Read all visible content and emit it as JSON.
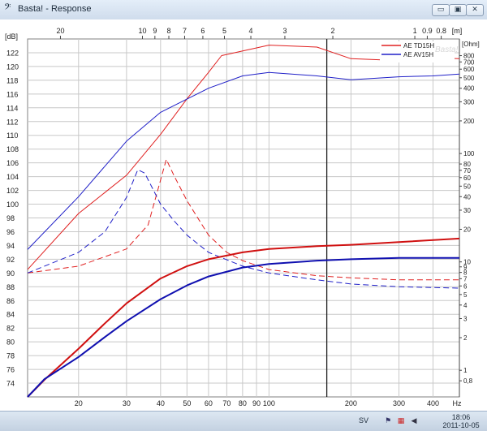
{
  "window": {
    "title": "Basta! - Response",
    "app_icon": "bass-clef-icon",
    "controls": {
      "minimize": "▭",
      "maximize": "▣",
      "close": "✕"
    }
  },
  "chart_data": {
    "type": "line",
    "xaxis": {
      "scale": "log",
      "range": [
        13,
        500
      ],
      "unit_label": "Hz",
      "ticks": [
        20,
        30,
        40,
        50,
        60,
        70,
        80,
        90,
        100,
        200,
        300,
        400
      ]
    },
    "topaxis": {
      "unit_label": "[m]",
      "range_m": [
        26.4,
        0.686
      ],
      "ticks": [
        20,
        10,
        9,
        8,
        7,
        6,
        5,
        4,
        3,
        2,
        1,
        0.9,
        0.8
      ]
    },
    "yaxis": {
      "unit_label": "[dB]",
      "range": [
        72,
        124
      ],
      "ticks": [
        74,
        76,
        78,
        80,
        82,
        84,
        86,
        88,
        90,
        92,
        94,
        96,
        98,
        100,
        102,
        104,
        106,
        108,
        110,
        112,
        114,
        116,
        118,
        120,
        122
      ]
    },
    "y2axis": {
      "unit_label": "[Ohm]",
      "scale": "log",
      "range": [
        0.568,
        1140
      ],
      "ticks": [
        "0,8",
        "1",
        "2",
        "3",
        "4",
        "5",
        "6",
        "7",
        "8",
        "9",
        "10",
        "20",
        "30",
        "40",
        "50",
        "60",
        "70",
        "80",
        "100",
        "200",
        "300",
        "400",
        "500",
        "600",
        "700",
        "800"
      ]
    },
    "grid": true,
    "vertical_marker_hz": 163,
    "legend": {
      "placement": "top-right",
      "watermark": "Basta!"
    },
    "series": [
      {
        "name": "AE TD15H",
        "color": "#e02020",
        "axis": "ohm",
        "style": "thin",
        "points": [
          [
            13,
            8.5
          ],
          [
            20,
            28
          ],
          [
            30,
            63
          ],
          [
            40,
            150
          ],
          [
            50,
            320
          ],
          [
            60,
            560
          ],
          [
            67,
            800
          ],
          [
            100,
            1000
          ],
          [
            150,
            960
          ],
          [
            200,
            750
          ],
          [
            300,
            720
          ],
          [
            400,
            760
          ],
          [
            500,
            750
          ]
        ]
      },
      {
        "name": "AE AV15H",
        "color": "#2020c8",
        "axis": "ohm",
        "style": "thin",
        "points": [
          [
            13,
            13
          ],
          [
            20,
            40
          ],
          [
            30,
            130
          ],
          [
            40,
            240
          ],
          [
            60,
            400
          ],
          [
            80,
            520
          ],
          [
            100,
            560
          ],
          [
            150,
            520
          ],
          [
            200,
            480
          ],
          [
            300,
            510
          ],
          [
            400,
            520
          ],
          [
            500,
            540
          ]
        ]
      },
      {
        "name": "AE TD15H",
        "color": "#e02020",
        "axis": "db",
        "style": "dashed",
        "points": [
          [
            13,
            90
          ],
          [
            20,
            91
          ],
          [
            30,
            93.5
          ],
          [
            36,
            97
          ],
          [
            40,
            103.5
          ],
          [
            42,
            106.5
          ],
          [
            45,
            104
          ],
          [
            50,
            100.5
          ],
          [
            60,
            95.5
          ],
          [
            70,
            93
          ],
          [
            80,
            91.8
          ],
          [
            100,
            90.5
          ],
          [
            150,
            89.6
          ],
          [
            200,
            89.3
          ],
          [
            300,
            89
          ],
          [
            500,
            89
          ]
        ]
      },
      {
        "name": "AE AV15H",
        "color": "#2020c8",
        "axis": "db",
        "style": "dashed",
        "points": [
          [
            13,
            90
          ],
          [
            20,
            93
          ],
          [
            25,
            96
          ],
          [
            30,
            101
          ],
          [
            33,
            105
          ],
          [
            35,
            104.5
          ],
          [
            40,
            100
          ],
          [
            45,
            97.5
          ],
          [
            50,
            95.5
          ],
          [
            60,
            93
          ],
          [
            80,
            91
          ],
          [
            100,
            90
          ],
          [
            150,
            89
          ],
          [
            200,
            88.4
          ],
          [
            300,
            88
          ],
          [
            500,
            87.8
          ]
        ]
      },
      {
        "name": "AE TD15H",
        "color": "#d01010",
        "axis": "db",
        "style": "thick",
        "points": [
          [
            13,
            72
          ],
          [
            15,
            74.5
          ],
          [
            20,
            79
          ],
          [
            25,
            82.7
          ],
          [
            30,
            85.6
          ],
          [
            40,
            89.2
          ],
          [
            50,
            91
          ],
          [
            60,
            92
          ],
          [
            80,
            93
          ],
          [
            100,
            93.5
          ],
          [
            150,
            93.9
          ],
          [
            200,
            94.1
          ],
          [
            300,
            94.5
          ],
          [
            500,
            95
          ]
        ]
      },
      {
        "name": "AE AV15H",
        "color": "#1010b0",
        "axis": "db",
        "style": "thick",
        "points": [
          [
            13,
            72
          ],
          [
            15,
            74.6
          ],
          [
            20,
            77.8
          ],
          [
            25,
            80.7
          ],
          [
            30,
            83
          ],
          [
            40,
            86.2
          ],
          [
            50,
            88.2
          ],
          [
            60,
            89.5
          ],
          [
            80,
            90.8
          ],
          [
            100,
            91.3
          ],
          [
            150,
            91.8
          ],
          [
            200,
            92
          ],
          [
            300,
            92.2
          ],
          [
            500,
            92.2
          ]
        ]
      }
    ]
  },
  "taskbar": {
    "language": "SV",
    "time": "18:06",
    "date": "2011-10-05",
    "tray_icons": [
      "action-center-icon",
      "network-icon",
      "volume-icon"
    ]
  }
}
